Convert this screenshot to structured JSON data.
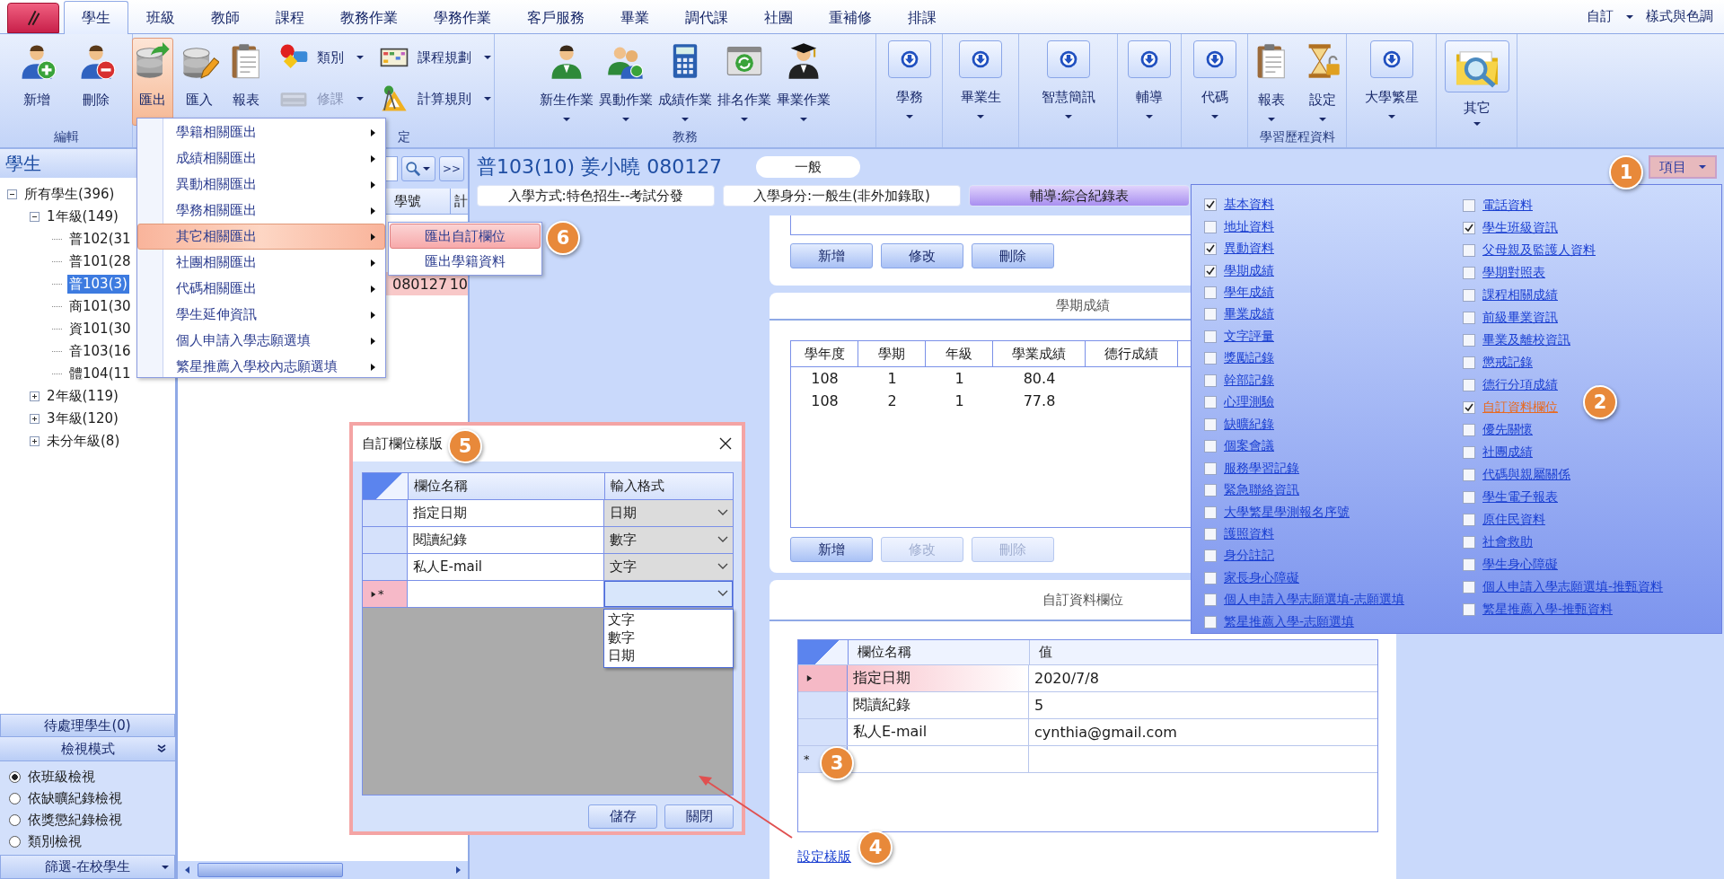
{
  "app_tabs": {
    "tabs": [
      {
        "label": "學生",
        "selected": true
      },
      {
        "label": "班級",
        "selected": false
      },
      {
        "label": "教師",
        "selected": false
      },
      {
        "label": "課程",
        "selected": false
      },
      {
        "label": "教務作業",
        "selected": false
      },
      {
        "label": "學務作業",
        "selected": false
      },
      {
        "label": "客戶服務",
        "selected": false
      },
      {
        "label": "畢業",
        "selected": false
      },
      {
        "label": "調代課",
        "selected": false
      },
      {
        "label": "社團",
        "selected": false
      },
      {
        "label": "重補修",
        "selected": false
      },
      {
        "label": "排課",
        "selected": false
      }
    ],
    "right_menu": "自訂",
    "style_menu": "樣式與色調"
  },
  "ribbon": {
    "groups": [
      {
        "label": "編輯",
        "items": [
          {
            "label": "新增",
            "kind": "plain"
          },
          {
            "label": "刪除",
            "kind": "plain"
          }
        ]
      },
      {
        "label": "定",
        "items": [
          {
            "label": "匯出",
            "kind": "big",
            "active": true,
            "disabled": false
          },
          {
            "label": "匯入",
            "kind": "big",
            "active": false,
            "disabled": false
          },
          {
            "label": "報表",
            "kind": "big",
            "active": false,
            "disabled": false
          },
          {
            "label": "類別",
            "kind": "small",
            "active": false,
            "disabled": false
          },
          {
            "label": "修課",
            "kind": "small",
            "active": false,
            "disabled": true
          },
          {
            "label": "課程規劃",
            "kind": "small",
            "active": false,
            "disabled": false
          },
          {
            "label": "計算規則",
            "kind": "small",
            "active": false,
            "disabled": false
          }
        ]
      },
      {
        "label": "教務",
        "items": [
          {
            "label": "新生作業",
            "kind": "big"
          },
          {
            "label": "異動作業",
            "kind": "big"
          },
          {
            "label": "成績作業",
            "kind": "big"
          },
          {
            "label": "排名作業",
            "kind": "big"
          },
          {
            "label": "畢業作業",
            "kind": "big"
          }
        ]
      },
      {
        "items": [
          {
            "label": "學務",
            "kind": "tile"
          }
        ]
      },
      {
        "items": [
          {
            "label": "畢業生",
            "kind": "tile"
          }
        ]
      },
      {
        "items": [
          {
            "label": "智慧簡訊",
            "kind": "tile"
          }
        ]
      },
      {
        "items": [
          {
            "label": "輔導",
            "kind": "tile"
          }
        ]
      },
      {
        "items": [
          {
            "label": "代碼",
            "kind": "tile"
          }
        ]
      },
      {
        "label": "學習歷程資料",
        "items": [
          {
            "label": "報表",
            "kind": "big"
          },
          {
            "label": "設定",
            "kind": "big"
          }
        ]
      },
      {
        "items": [
          {
            "label": "大學繁星",
            "kind": "tile"
          }
        ]
      },
      {
        "items": [
          {
            "label": "其它",
            "kind": "large-tile"
          }
        ]
      }
    ]
  },
  "student_tree": {
    "title": "學生",
    "nodes": [
      {
        "label": "所有學生(396)",
        "expanded": true,
        "selected": false,
        "children": [
          {
            "label": "1年級(149)",
            "expanded": true,
            "selected": false,
            "children": [
              {
                "label": "普102(31",
                "selected": false
              },
              {
                "label": "普101(28",
                "selected": false
              },
              {
                "label": "普103(3)",
                "selected": true
              },
              {
                "label": "商101(30",
                "selected": false
              },
              {
                "label": "資101(30",
                "selected": false
              },
              {
                "label": "音103(16",
                "selected": false
              },
              {
                "label": "體104(11",
                "selected": false
              }
            ]
          },
          {
            "label": "2年級(119)",
            "expanded": false,
            "selected": false
          },
          {
            "label": "3年級(120)",
            "expanded": false,
            "selected": false
          },
          {
            "label": "未分年級(8)",
            "expanded": false,
            "selected": false
          }
        ]
      }
    ]
  },
  "pending_button": "待處理學生(0)",
  "view_mode": {
    "title": "檢視模式",
    "options": [
      {
        "label": "依班級檢視",
        "selected": true
      },
      {
        "label": "依缺曠紀錄檢視",
        "selected": false
      },
      {
        "label": "依獎懲紀錄檢視",
        "selected": false
      },
      {
        "label": "類別檢視",
        "selected": false
      }
    ]
  },
  "filter": "篩選-在校學生",
  "student_list": {
    "next_button": ">>",
    "columns": [
      "學號",
      "計"
    ],
    "rows": [
      {
        "cells": [
          "080127",
          "10"
        ],
        "selected": true
      }
    ]
  },
  "student_header": {
    "title": "普103(10) 姜小曉 080127",
    "status": "一般"
  },
  "info_tabs": [
    {
      "label": "入學方式:特色招生--考試分發",
      "selected": false
    },
    {
      "label": "入學身分:一般生(非外加錄取)",
      "selected": false
    },
    {
      "label": "輔導:綜合紀錄表",
      "selected": true
    }
  ],
  "items_button": "項目",
  "top_card": {
    "buttons": [
      {
        "label": "新增",
        "disabled": false
      },
      {
        "label": "修改",
        "disabled": false
      },
      {
        "label": "刪除",
        "disabled": false
      }
    ]
  },
  "semester_grades": {
    "title": "學期成績",
    "columns": [
      "學年度",
      "學期",
      "年級",
      "學業成績",
      "德行成績"
    ],
    "rows": [
      [
        "108",
        "1",
        "1",
        "80.4",
        ""
      ],
      [
        "108",
        "2",
        "1",
        "77.8",
        ""
      ]
    ],
    "buttons": [
      {
        "label": "新增",
        "disabled": false
      },
      {
        "label": "修改",
        "disabled": true
      },
      {
        "label": "刪除",
        "disabled": true
      }
    ]
  },
  "custom_fields": {
    "title": "自訂資料欄位",
    "columns": [
      "欄位名稱",
      "值"
    ],
    "rows": [
      {
        "cells": [
          "指定日期",
          "2020/7/8"
        ],
        "current": true
      },
      {
        "cells": [
          "閱讀紀錄",
          "5"
        ],
        "current": false
      },
      {
        "cells": [
          "私人E-mail",
          "cynthia@gmail.com"
        ],
        "current": false
      }
    ],
    "new_row_marker": "*",
    "link": "設定樣版"
  },
  "export_menu": {
    "items": [
      {
        "label": "學籍相關匯出",
        "selected": false
      },
      {
        "label": "成績相關匯出",
        "selected": false
      },
      {
        "label": "異動相關匯出",
        "selected": false
      },
      {
        "label": "學務相關匯出",
        "selected": false
      },
      {
        "label": "其它相關匯出",
        "selected": true
      },
      {
        "label": "社團相關匯出",
        "selected": false
      },
      {
        "label": "代碼相關匯出",
        "selected": false
      },
      {
        "label": "學生延伸資訊",
        "selected": false
      },
      {
        "label": "個人申請入學志願選填",
        "selected": false
      },
      {
        "label": "繁星推薦入學校內志願選填",
        "selected": false
      }
    ]
  },
  "export_submenu": {
    "items": [
      {
        "label": "匯出自訂欄位",
        "selected": true
      },
      {
        "label": "匯出學籍資料",
        "selected": false
      }
    ]
  },
  "items_panel": {
    "columns": [
      {
        "items": [
          {
            "label": "基本資料",
            "checked": true,
            "selected": false
          },
          {
            "label": "地址資料",
            "checked": false,
            "selected": false
          },
          {
            "label": "異動資料",
            "checked": true,
            "selected": false
          },
          {
            "label": "學期成績",
            "checked": true,
            "selected": false
          },
          {
            "label": "學年成績",
            "checked": false,
            "selected": false
          },
          {
            "label": "畢業成績",
            "checked": false,
            "selected": false
          },
          {
            "label": "文字評量",
            "checked": false,
            "selected": false
          },
          {
            "label": "獎勵記錄",
            "checked": false,
            "selected": false
          },
          {
            "label": "幹部記錄",
            "checked": false,
            "selected": false
          },
          {
            "label": "心理測驗",
            "checked": false,
            "selected": false
          },
          {
            "label": "缺曠紀錄",
            "checked": false,
            "selected": false
          },
          {
            "label": "個案會議",
            "checked": false,
            "selected": false
          },
          {
            "label": "服務學習記錄",
            "checked": false,
            "selected": false
          },
          {
            "label": "緊急聯絡資訊",
            "checked": false,
            "selected": false
          },
          {
            "label": "大學繁星學測報名序號",
            "checked": false,
            "selected": false
          },
          {
            "label": "護照資料",
            "checked": false,
            "selected": false
          },
          {
            "label": "身分註記",
            "checked": false,
            "selected": false
          },
          {
            "label": "家長身心障礙",
            "checked": false,
            "selected": false
          },
          {
            "label": "個人申請入學志願選填-志願選填",
            "checked": false,
            "selected": false
          },
          {
            "label": "繁星推薦入學-志願選填",
            "checked": false,
            "selected": false
          }
        ]
      },
      {
        "items": [
          {
            "label": "電話資料",
            "checked": false,
            "selected": false
          },
          {
            "label": "學生班級資訊",
            "checked": true,
            "selected": false
          },
          {
            "label": "父母親及監護人資料",
            "checked": false,
            "selected": false
          },
          {
            "label": "學期對照表",
            "checked": false,
            "selected": false
          },
          {
            "label": "課程相關成績",
            "checked": false,
            "selected": false
          },
          {
            "label": "前級畢業資訊",
            "checked": false,
            "selected": false
          },
          {
            "label": "畢業及離校資訊",
            "checked": false,
            "selected": false
          },
          {
            "label": "懲戒記錄",
            "checked": false,
            "selected": false
          },
          {
            "label": "德行分項成績",
            "checked": false,
            "selected": false
          },
          {
            "label": "自訂資料欄位",
            "checked": true,
            "selected": true
          },
          {
            "label": "優先關懷",
            "checked": false,
            "selected": false
          },
          {
            "label": "社團成績",
            "checked": false,
            "selected": false
          },
          {
            "label": "代碼與親屬關係",
            "checked": false,
            "selected": false
          },
          {
            "label": "學生電子報表",
            "checked": false,
            "selected": false
          },
          {
            "label": "原住民資料",
            "checked": false,
            "selected": false
          },
          {
            "label": "社會救助",
            "checked": false,
            "selected": false
          },
          {
            "label": "學生身心障礙",
            "checked": false,
            "selected": false
          },
          {
            "label": "個人申請入學志願選填-推甄資料",
            "checked": false,
            "selected": false
          },
          {
            "label": "繁星推薦入學-推甄資料",
            "checked": false,
            "selected": false
          }
        ]
      }
    ]
  },
  "dialog": {
    "title": "自訂欄位樣版",
    "columns": [
      "欄位名稱",
      "輸入格式"
    ],
    "rows": [
      {
        "name": "指定日期",
        "format": "日期"
      },
      {
        "name": "閱讀紀錄",
        "format": "數字"
      },
      {
        "name": "私人E-mail",
        "format": "文字"
      }
    ],
    "new_row_marker": "*",
    "open_options": [
      "文字",
      "數字",
      "日期"
    ],
    "buttons": [
      "儲存",
      "關閉"
    ]
  },
  "callouts": [
    "1",
    "2",
    "3",
    "4",
    "5",
    "6"
  ]
}
